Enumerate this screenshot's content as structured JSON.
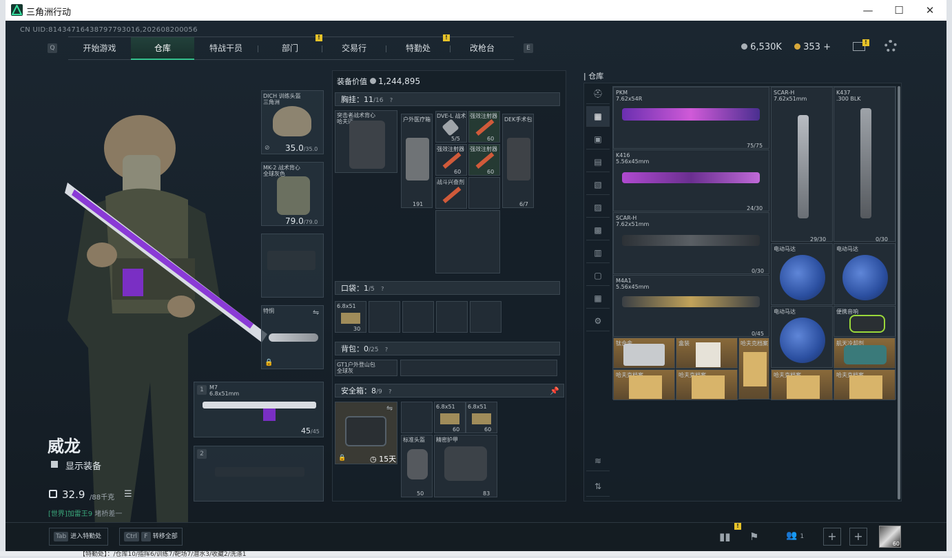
{
  "window": {
    "title": "三角洲行动",
    "minimize": "—",
    "maximize": "☐",
    "close": "✕"
  },
  "uid": "CN UID:8143471643879779301​6,202608200056",
  "nav": {
    "key_left": "Q",
    "key_right": "E",
    "tabs": [
      "开始游戏",
      "仓库",
      "特战干员",
      "部门",
      "交易行",
      "特勤处",
      "改枪台"
    ],
    "active": 1
  },
  "currency": {
    "silver": "6,530K",
    "gold": "353",
    "plus": "+"
  },
  "character": {
    "name": "威龙",
    "show_gear": "显示装备",
    "weight": "32.9",
    "weight_max": "/88千克",
    "world_prefix": "[世界]",
    "world_name": "加雷王9",
    "world_msg": "堵桥差一"
  },
  "equip": {
    "helmet": {
      "name": "DICH 训练头盔",
      "sub": "三角洲",
      "dur": "35.0",
      "dur_max": "/35.0"
    },
    "armor": {
      "name": "MK-2 战术背心",
      "sub": "全球灰色",
      "dur": "79.0",
      "dur_max": "/79.0"
    },
    "melee": {
      "name": "特恫"
    },
    "primary": {
      "slot": "1",
      "name": "M7",
      "cal": "6.8x51mm",
      "ammo": "45",
      "ammo_max": "/45"
    },
    "secondary": {
      "slot": "2"
    }
  },
  "loadout": {
    "value_label": "装备价值",
    "value": "1,244,895",
    "chest": {
      "label": "胸挂：",
      "count": "11",
      "max": "/16",
      "rig": "突击者战术背心",
      "rig_sub": "哈夫迈",
      "medkit": "户外医疗箱",
      "medkit_val": "191",
      "dve": "DVE-L 战术",
      "dve_val": "5/5",
      "inj1": "强效注射器",
      "inj2": "强效注射器",
      "inj3": "强效注射器",
      "inj4": "强效注射器",
      "inj_val": "60",
      "drug": "战斗兴奋剂",
      "dek": "DEK手术包",
      "dek_val": "6/7"
    },
    "pocket": {
      "label": "口袋：",
      "count": "1",
      "max": "/5",
      "ammo": "6.8x51",
      "ammo_val": "30"
    },
    "backpack": {
      "label": "背包：",
      "count": "0",
      "max": "/25",
      "item": "GT1户外登山包",
      "item_sub": "全球灰"
    },
    "safe": {
      "label": "安全箱：",
      "count": "8",
      "max": "/9",
      "days": "15天",
      "a1": "6.8x51",
      "a1v": "60",
      "a2": "6.8x51",
      "a2v": "60",
      "helmet": "标准头盔",
      "helmet_v": "50",
      "armor": "精密护甲",
      "armor_v": "83"
    }
  },
  "stash": {
    "title": "仓库",
    "items": [
      {
        "name": "PKM",
        "cal": "7.62x54R",
        "val": "75/75"
      },
      {
        "name": "SCAR-H",
        "cal": "7.62x51mm",
        "val": "29/30"
      },
      {
        "name": "K437",
        "cal": ".300 BLK",
        "val": "0/30"
      },
      {
        "name": "K416",
        "cal": "5.56x45mm",
        "val": "24/30"
      },
      {
        "name": "SCAR-H",
        "cal": "7.62x51mm",
        "val": "0/30"
      },
      {
        "name": "M4A1",
        "cal": "5.56x45mm",
        "val": "0/45"
      },
      {
        "name": "电动马达"
      },
      {
        "name": "电动马达"
      },
      {
        "name": "电动马达"
      },
      {
        "name": "便携音响"
      },
      {
        "name": "钛合金"
      },
      {
        "name": "盒装"
      },
      {
        "name": "哈夫克档案"
      },
      {
        "name": "航天冷却剂"
      },
      {
        "name": "哈夫克档案"
      },
      {
        "name": "哈夫克档案"
      },
      {
        "name": "哈夫克档案"
      },
      {
        "name": "哈夫克档案"
      }
    ]
  },
  "bottom": {
    "tab_key": "Tab",
    "tab_label": "进入特勤处",
    "ctrl_key": "Ctrl",
    "f_key": "F",
    "transfer_label": "转移全部",
    "friends": "1",
    "level": "60"
  },
  "strip": "【特勤处】：/仓库10/指挥6/训练7/靶场7/潜水3/收藏2/洗涤1"
}
